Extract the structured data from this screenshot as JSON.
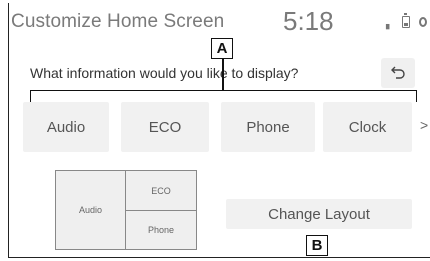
{
  "header": {
    "title": "Customize Home Screen",
    "time": "5:18"
  },
  "status": {
    "signal_icon": "signal-icon",
    "battery_icon": "battery-icon",
    "wifi_icon": "wifi-icon"
  },
  "prompt": "What information would you like to display?",
  "back_icon": "back-arrow-icon",
  "callouts": {
    "a": "A",
    "b": "B"
  },
  "tiles": [
    {
      "label": "Audio"
    },
    {
      "label": "ECO"
    },
    {
      "label": "Phone"
    },
    {
      "label": "Clock"
    }
  ],
  "more_icon": "chevron-right-icon",
  "more_label": ">",
  "layout_preview": {
    "left": "Audio",
    "top_right": "ECO",
    "bottom_right": "Phone"
  },
  "change_layout_label": "Change Layout"
}
